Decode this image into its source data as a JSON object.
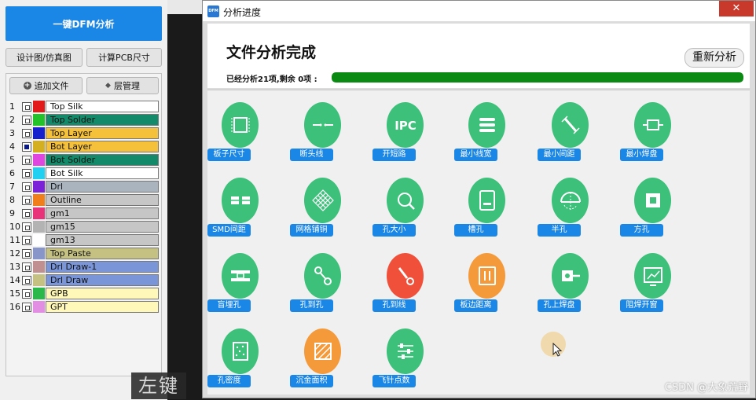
{
  "left_panel": {
    "dfm_button": "一键DFM分析",
    "design_view_button": "设计图/仿真图",
    "calc_pcb_button": "计算PCB尺寸",
    "add_file_button": "追加文件",
    "layer_manage_button": "层管理",
    "layers": [
      {
        "num": "1",
        "name": "Top Silk",
        "color": "#e21a1a",
        "bg": "#ffffff",
        "checked": false
      },
      {
        "num": "2",
        "name": "Top Solder",
        "color": "#22c22a",
        "bg": "#138a6a",
        "checked": false
      },
      {
        "num": "3",
        "name": "Top Layer",
        "color": "#1620cc",
        "bg": "#f5c03a",
        "checked": false
      },
      {
        "num": "4",
        "name": "Bot Layer",
        "color": "#d4b020",
        "bg": "#f5c03a",
        "checked": true
      },
      {
        "num": "5",
        "name": "Bot Solder",
        "color": "#e046e0",
        "bg": "#138a6a",
        "checked": false
      },
      {
        "num": "6",
        "name": "Bot Silk",
        "color": "#1fd0f0",
        "bg": "#ffffff",
        "checked": false
      },
      {
        "num": "7",
        "name": "Drl",
        "color": "#7b22d8",
        "bg": "#a9b4bf",
        "checked": false
      },
      {
        "num": "8",
        "name": "Outline",
        "color": "#f07e1a",
        "bg": "#c6c6c6",
        "checked": false
      },
      {
        "num": "9",
        "name": "gm1",
        "color": "#e8327a",
        "bg": "#c6c6c6",
        "checked": false
      },
      {
        "num": "10",
        "name": "gm15",
        "color": "#b3b3b3",
        "bg": "#c6c6c6",
        "checked": false
      },
      {
        "num": "11",
        "name": "gm13",
        "color": "#ffffff",
        "bg": "#c6c6c6",
        "checked": false
      },
      {
        "num": "12",
        "name": "Top Paste",
        "color": "#8895c8",
        "bg": "#c4c182",
        "checked": false
      },
      {
        "num": "13",
        "name": "Drl Draw-1",
        "color": "#c08f8f",
        "bg": "#7b96d8",
        "checked": false
      },
      {
        "num": "14",
        "name": "Drl Draw",
        "color": "#c4c182",
        "bg": "#7b96d8",
        "checked": false
      },
      {
        "num": "15",
        "name": "GPB",
        "color": "#2ab84a",
        "bg": "#fff8b8",
        "checked": false
      },
      {
        "num": "16",
        "name": "GPT",
        "color": "#e28ee2",
        "bg": "#fff8b8",
        "checked": false
      }
    ],
    "left_key_label": "左键"
  },
  "dialog": {
    "title": "分析进度",
    "app_icon_text": "DFM",
    "close_symbol": "✕",
    "status_title": "文件分析完成",
    "reanalyze_button": "重新分析",
    "progress_text": "已经分析21项,剩余 0项 :",
    "progress_fraction": 1.0,
    "items": [
      {
        "label": "板子尺寸",
        "color": "#3cc07a",
        "icon": "board-size-icon"
      },
      {
        "label": "断头线",
        "color": "#3cc07a",
        "icon": "broken-line-icon"
      },
      {
        "label": "开短路",
        "color": "#3cc07a",
        "icon": "ipc-open-short-icon",
        "icon_text": "IPC"
      },
      {
        "label": "最小线宽",
        "color": "#3cc07a",
        "icon": "min-trace-width-icon"
      },
      {
        "label": "最小间距",
        "color": "#3cc07a",
        "icon": "min-spacing-icon"
      },
      {
        "label": "最小焊盘",
        "color": "#3cc07a",
        "icon": "min-pad-icon"
      },
      {
        "label": "SMD间距",
        "color": "#3cc07a",
        "icon": "smd-spacing-icon"
      },
      {
        "label": "网格铺铜",
        "color": "#3cc07a",
        "icon": "grid-copper-icon"
      },
      {
        "label": "孔大小",
        "color": "#3cc07a",
        "icon": "hole-size-icon"
      },
      {
        "label": "槽孔",
        "color": "#3cc07a",
        "icon": "slot-hole-icon"
      },
      {
        "label": "半孔",
        "color": "#3cc07a",
        "icon": "half-hole-icon"
      },
      {
        "label": "方孔",
        "color": "#3cc07a",
        "icon": "square-hole-icon"
      },
      {
        "label": "盲埋孔",
        "color": "#3cc07a",
        "icon": "blind-buried-via-icon"
      },
      {
        "label": "孔到孔",
        "color": "#3cc07a",
        "icon": "hole-to-hole-icon"
      },
      {
        "label": "孔到线",
        "color": "#f0503a",
        "icon": "hole-to-line-icon"
      },
      {
        "label": "板边距离",
        "color": "#f59a3a",
        "icon": "board-edge-distance-icon"
      },
      {
        "label": "孔上焊盘",
        "color": "#3cc07a",
        "icon": "pad-on-hole-icon"
      },
      {
        "label": "阻焊开窗",
        "color": "#3cc07a",
        "icon": "solder-mask-opening-icon"
      },
      {
        "label": "孔密度",
        "color": "#3cc07a",
        "icon": "hole-density-icon"
      },
      {
        "label": "沉金面积",
        "color": "#f59a3a",
        "icon": "gold-area-icon"
      },
      {
        "label": "飞针点数",
        "color": "#3cc07a",
        "icon": "flying-probe-points-icon"
      }
    ]
  },
  "watermark": "CSDN @大象荒野"
}
